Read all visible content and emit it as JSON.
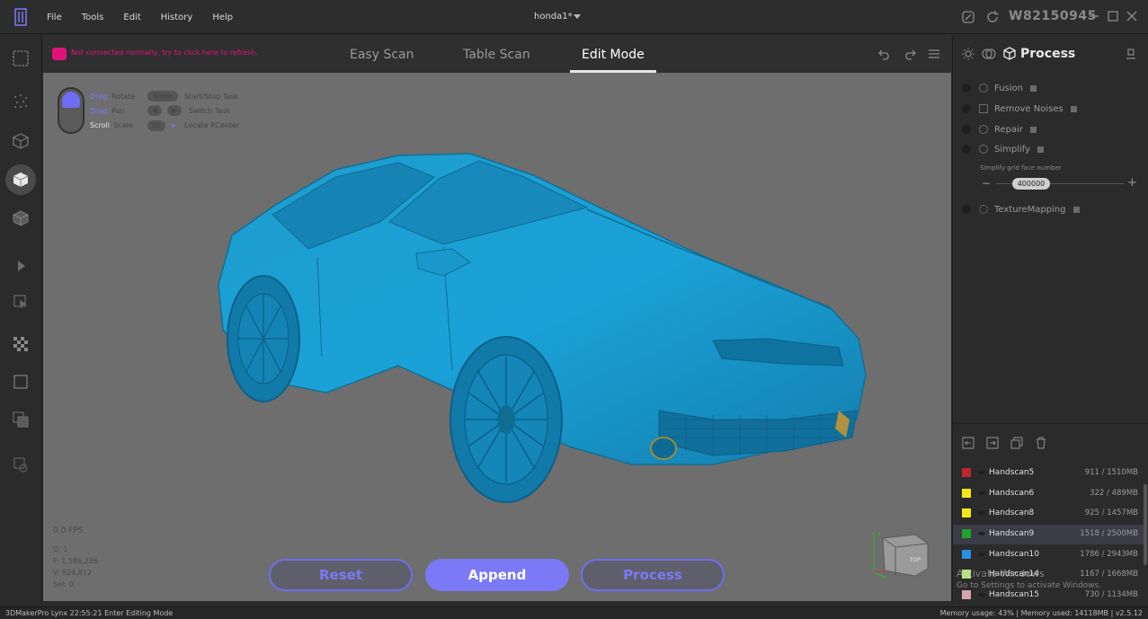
{
  "app": {
    "title": "honda1*",
    "user_id": "W82150945",
    "menu": [
      "File",
      "Tools",
      "Edit",
      "History",
      "Help"
    ]
  },
  "colors": {
    "accent": "#7b79f5",
    "warning": "#e0127c",
    "model": "#1ea4d6",
    "viewport_bg": "#6e6e6e"
  },
  "viewport": {
    "warning_text": "Not connected normally, try to click here to refresh.",
    "tabs": [
      {
        "label": "Easy Scan",
        "active": false
      },
      {
        "label": "Table Scan",
        "active": false
      },
      {
        "label": "Edit Mode",
        "active": true
      }
    ],
    "hints": {
      "drag1": "Drag",
      "rotate": "Rotate",
      "drag2": "Drag",
      "pan": "Pan",
      "scroll": "Scroll",
      "scale": "Scale",
      "space": "Space",
      "start_stop": "Start/Stop Task",
      "switch": "Switch Task",
      "alt": "Alt",
      "locate": "Locate RCenter"
    },
    "fps": "0.0 FPS",
    "stats": [
      "O: 1",
      "F: 1,586,226",
      "V: 824,812",
      "Sel: 0"
    ],
    "buttons": {
      "reset": "Reset",
      "append": "Append",
      "process": "Process"
    },
    "navcube_label": "TOP"
  },
  "process_panel": {
    "title": "Process",
    "items": [
      {
        "label": "Fusion"
      },
      {
        "label": "Remove Noises"
      },
      {
        "label": "Repair"
      },
      {
        "label": "Simplify"
      },
      {
        "label": "TextureMapping"
      }
    ],
    "simplify_label": "Simplify grid face number",
    "simplify_value": "400000",
    "minus": "−",
    "plus": "+"
  },
  "scans": [
    {
      "name": "Handscan5",
      "size": "911 / 1510MB",
      "color": "#c0262e"
    },
    {
      "name": "Handscan6",
      "size": "322 / 489MB",
      "color": "#f1e71a"
    },
    {
      "name": "Handscan8",
      "size": "925 / 1457MB",
      "color": "#f1e71a"
    },
    {
      "name": "Handscan9",
      "size": "1518 / 2500MB",
      "color": "#1fa32f"
    },
    {
      "name": "Handscan10",
      "size": "1786 / 2943MB",
      "color": "#2b8fe0"
    },
    {
      "name": "Handscan14",
      "size": "1167 / 1668MB",
      "color": "#b6e27a"
    },
    {
      "name": "Handscan15",
      "size": "730 / 1134MB",
      "color": "#d6a3b0"
    }
  ],
  "watermark": {
    "line1": "Activate Windows",
    "line2": "Go to Settings to activate Windows."
  },
  "status": {
    "left": "3DMakerPro Lynx   22:55:21 Enter Editing Mode",
    "right": "Memory usage: 43% | Memory used: 14118MB | v2.5.12"
  }
}
